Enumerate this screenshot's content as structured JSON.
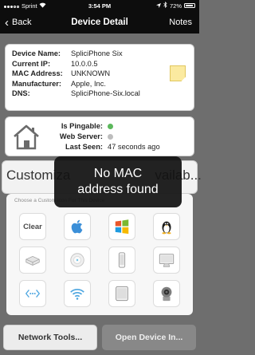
{
  "status_bar": {
    "carrier": "Sprint",
    "time": "3:54 PM",
    "battery": "72%"
  },
  "nav": {
    "back_label": "Back",
    "title": "Device Detail",
    "notes_label": "Notes"
  },
  "device": {
    "fields": [
      {
        "key": "Device Name:",
        "value": "SpliciPhone Six"
      },
      {
        "key": "Current IP:",
        "value": "10.0.0.5"
      },
      {
        "key": "MAC Address:",
        "value": "UNKNOWN"
      },
      {
        "key": "Manufacturer:",
        "value": "Apple, Inc."
      },
      {
        "key": "DNS:",
        "value": "SpliciPhone-Six.local"
      }
    ]
  },
  "status": {
    "pingable_label": "Is Pingable:",
    "pingable_color": "#5cb85c",
    "webserver_label": "Web Server:",
    "webserver_color": "#bdbdbd",
    "last_seen_label": "Last Seen:",
    "last_seen_value": "47 seconds ago"
  },
  "customize": {
    "label": "Customiza",
    "label_end": "vailab..."
  },
  "icon_picker": {
    "hint": "Choose a Custom Icon For This Device",
    "clear_label": "Clear",
    "icons": [
      "apple-icon",
      "windows-icon",
      "linux-icon",
      "router-icon",
      "smart-speaker-icon",
      "phone-icon",
      "monitor-icon",
      "network-icon",
      "wifi-icon",
      "tablet-icon",
      "camera-icon"
    ]
  },
  "toast": {
    "line1": "No MAC",
    "line2": "address found"
  },
  "buttons": {
    "network_tools": "Network Tools...",
    "open_device": "Open Device In..."
  }
}
